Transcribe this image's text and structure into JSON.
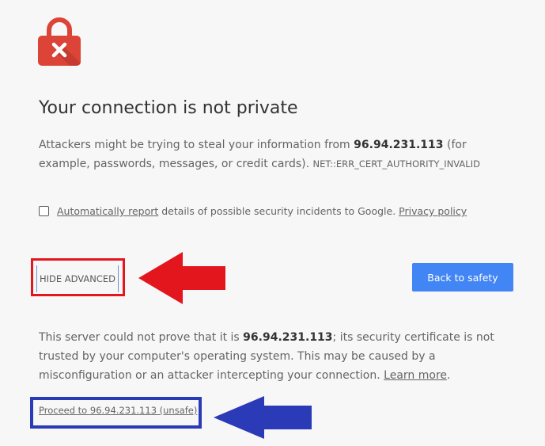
{
  "interstitial": {
    "title": "Your connection is not private",
    "desc_prefix": "Attackers might be trying to steal your information from ",
    "host": "96.94.231.113",
    "desc_suffix": " (for example, passwords, messages, or credit cards).",
    "error_code": "NET::ERR_CERT_AUTHORITY_INVALID",
    "report": {
      "checked": false,
      "link_label": "Automatically report",
      "text": " details of possible security incidents to Google. ",
      "privacy_label": "Privacy policy"
    },
    "hide_advanced_label": "HIDE ADVANCED",
    "back_button_label": "Back to safety",
    "details_prefix": "This server could not prove that it is ",
    "details_suffix": "; its security certificate is not trusted by your computer's operating system. This may be caused by a misconfiguration or an attacker intercepting your connection.",
    "learn_more_label": "Learn more",
    "details_end": ".",
    "proceed_label": "Proceed to 96.94.231.113 (unsafe)"
  },
  "icons": {
    "lock": "lock-error-icon",
    "red_arrow": "red-arrow-left",
    "blue_arrow": "blue-arrow-left"
  },
  "colors": {
    "lock_red": "#db4437",
    "button_blue": "#4285f4",
    "highlight_red": "#e3161d",
    "highlight_blue": "#2b3bb8",
    "background": "#f7f7f7"
  }
}
